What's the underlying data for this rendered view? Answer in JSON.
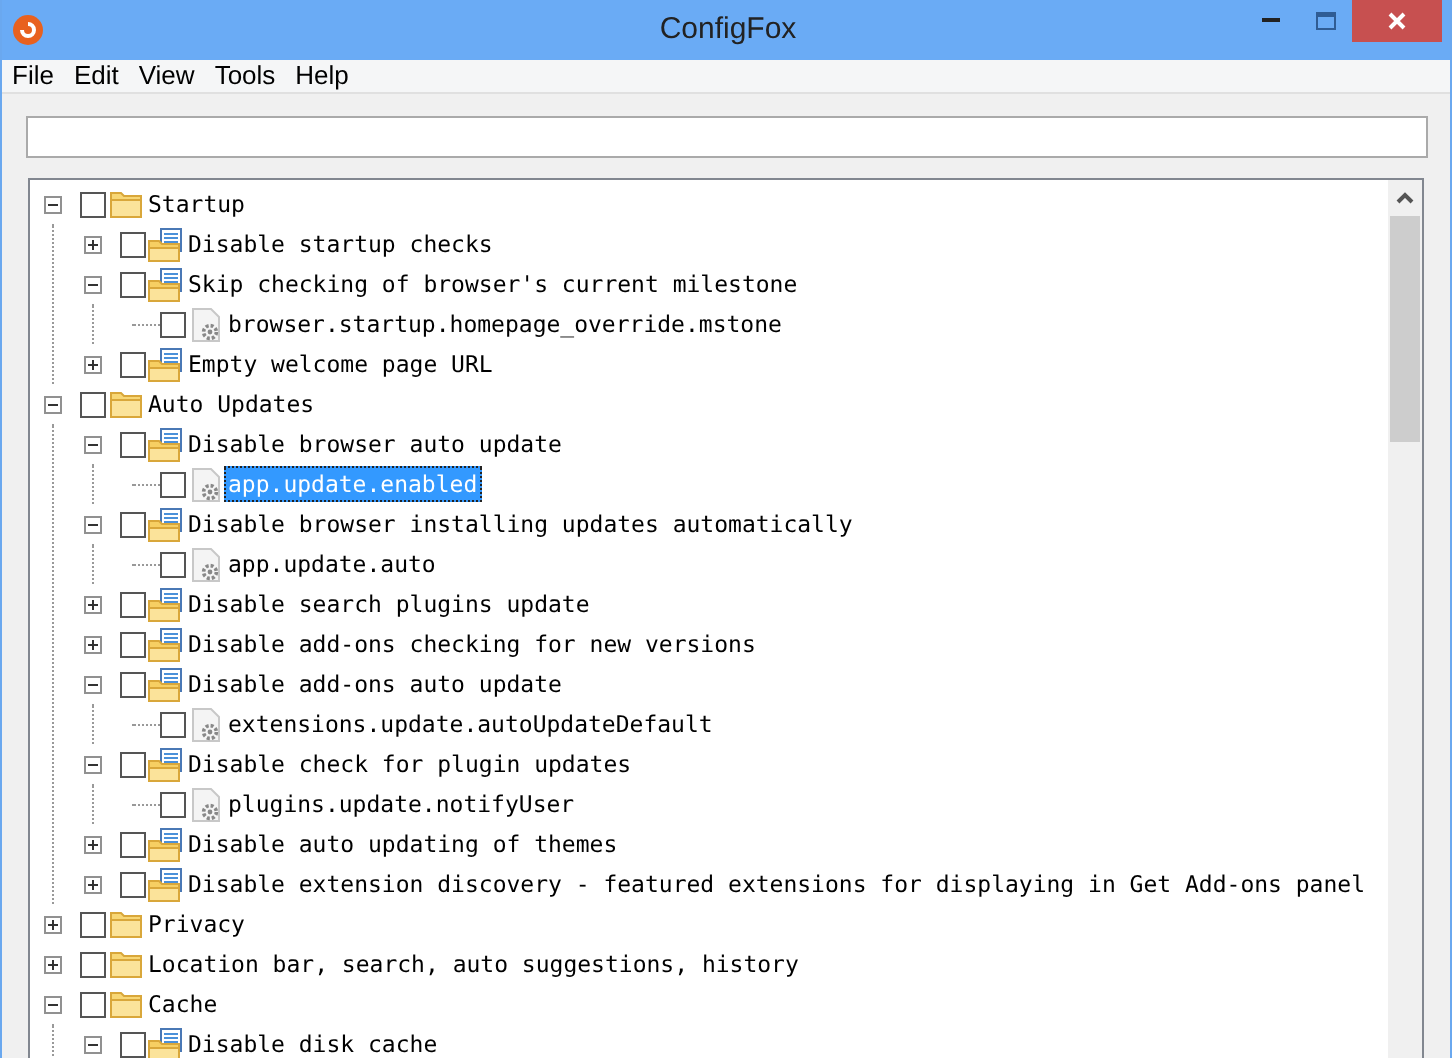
{
  "window": {
    "title": "ConfigFox"
  },
  "menu": [
    {
      "label": "File"
    },
    {
      "label": "Edit"
    },
    {
      "label": "View"
    },
    {
      "label": "Tools"
    },
    {
      "label": "Help"
    }
  ],
  "tree": [
    {
      "kind": "category",
      "label": "Startup",
      "expanded": true,
      "checked": false,
      "selected": false,
      "children": [
        {
          "kind": "group",
          "label": "Disable startup checks",
          "expanded": false,
          "checked": false,
          "selected": false
        },
        {
          "kind": "group",
          "label": "Skip checking of browser's current milestone",
          "expanded": true,
          "checked": false,
          "selected": false,
          "children": [
            {
              "kind": "setting",
              "label": "browser.startup.homepage_override.mstone",
              "checked": false,
              "selected": false
            }
          ]
        },
        {
          "kind": "group",
          "label": "Empty welcome page URL",
          "expanded": false,
          "checked": false,
          "selected": false
        }
      ]
    },
    {
      "kind": "category",
      "label": "Auto Updates",
      "expanded": true,
      "checked": false,
      "selected": false,
      "children": [
        {
          "kind": "group",
          "label": "Disable browser auto update",
          "expanded": true,
          "checked": false,
          "selected": false,
          "children": [
            {
              "kind": "setting",
              "label": "app.update.enabled",
              "checked": false,
              "selected": true
            }
          ]
        },
        {
          "kind": "group",
          "label": "Disable browser installing updates automatically",
          "expanded": true,
          "checked": false,
          "selected": false,
          "children": [
            {
              "kind": "setting",
              "label": "app.update.auto",
              "checked": false,
              "selected": false
            }
          ]
        },
        {
          "kind": "group",
          "label": "Disable search plugins update",
          "expanded": false,
          "checked": false,
          "selected": false
        },
        {
          "kind": "group",
          "label": "Disable add-ons checking for new versions",
          "expanded": false,
          "checked": false,
          "selected": false
        },
        {
          "kind": "group",
          "label": "Disable add-ons auto update",
          "expanded": true,
          "checked": false,
          "selected": false,
          "children": [
            {
              "kind": "setting",
              "label": "extensions.update.autoUpdateDefault",
              "checked": false,
              "selected": false
            }
          ]
        },
        {
          "kind": "group",
          "label": "Disable check for plugin updates",
          "expanded": true,
          "checked": false,
          "selected": false,
          "children": [
            {
              "kind": "setting",
              "label": "plugins.update.notifyUser",
              "checked": false,
              "selected": false
            }
          ]
        },
        {
          "kind": "group",
          "label": "Disable auto updating of themes",
          "expanded": false,
          "checked": false,
          "selected": false
        },
        {
          "kind": "group",
          "label": "Disable extension discovery - featured extensions for displaying in Get Add-ons panel",
          "expanded": false,
          "checked": false,
          "selected": false
        }
      ]
    },
    {
      "kind": "category",
      "label": "Privacy",
      "expanded": false,
      "checked": false,
      "selected": false
    },
    {
      "kind": "category",
      "label": "Location bar, search, auto suggestions, history",
      "expanded": false,
      "checked": false,
      "selected": false
    },
    {
      "kind": "category",
      "label": "Cache",
      "expanded": true,
      "checked": false,
      "selected": false,
      "children": [
        {
          "kind": "group",
          "label": "Disable disk cache",
          "expanded": true,
          "checked": false,
          "selected": false
        }
      ]
    }
  ]
}
